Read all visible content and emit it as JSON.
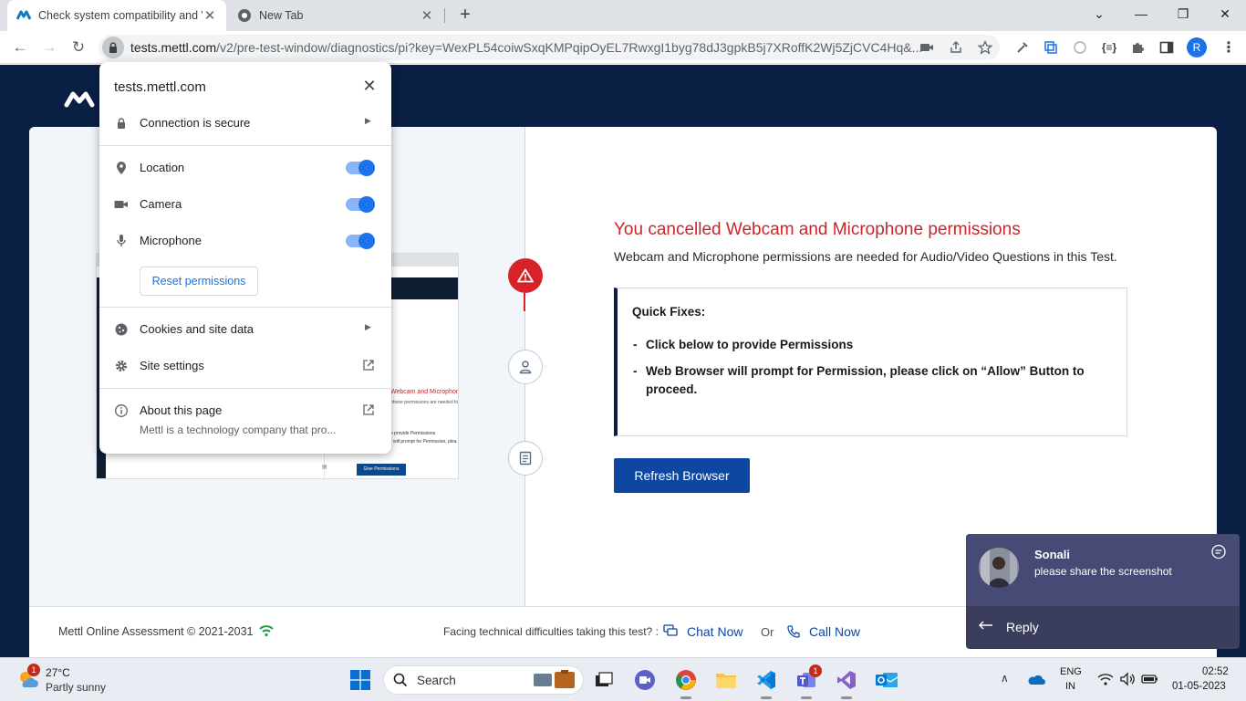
{
  "browser": {
    "tabs": [
      {
        "title": "Check system compatibility and Ve",
        "active": true
      },
      {
        "title": "New Tab",
        "active": false
      }
    ],
    "url_host": "tests.mettl.com",
    "url_path": "/v2/pre-test-window/diagnostics/pi?key=WexPL54coiwSxqKMPqipOyEL7RwxgI1byg78dJ3gpkB5j7XRoffK2Wj5ZjCVC4Hq&...",
    "profile_initial": "R",
    "window_controls": [
      "minimize",
      "restore",
      "close"
    ]
  },
  "site_info_popup": {
    "host": "tests.mettl.com",
    "connection_label": "Connection is secure",
    "permissions": [
      {
        "label": "Location",
        "icon": "location-pin-icon",
        "enabled": true
      },
      {
        "label": "Camera",
        "icon": "camera-icon",
        "enabled": true
      },
      {
        "label": "Microphone",
        "icon": "microphone-icon",
        "enabled": true
      }
    ],
    "reset_label": "Reset permissions",
    "cookies_label": "Cookies and site data",
    "site_settings_label": "Site settings",
    "about_label": "About this page",
    "about_sub": "Mettl is a technology company that pro..."
  },
  "preview_image": {
    "title": "Webcam and Microphor",
    "subtitle": "phone permissions are needed fo",
    "line1": "o provide Permissions",
    "line2": "r will prompt for Permission, plea",
    "button": "Give Permissions"
  },
  "main": {
    "error_title": "You cancelled Webcam and Microphone permissions",
    "error_subtitle": "Webcam and Microphone permissions are needed for Audio/Video Questions in this Test.",
    "fixes_heading": "Quick Fixes:",
    "fixes": [
      "Click below to provide Permissions",
      "Web Browser will prompt for Permission, please click on “Allow” Button to proceed."
    ],
    "dash": "-",
    "refresh_button": "Refresh Browser"
  },
  "footer": {
    "copyright": "Mettl Online Assessment © 2021-2031",
    "help_text": "Facing technical difficulties taking this test? :",
    "chat_label": "Chat Now",
    "or_label": "Or",
    "call_label": "Call Now"
  },
  "toast": {
    "sender": "Sonali",
    "message": "please share the screenshot",
    "reply_label": "Reply"
  },
  "taskbar": {
    "weather_temp": "27°C",
    "weather_desc": "Partly sunny",
    "weather_badge": "1",
    "search_label": "Search",
    "teams_badge": "1",
    "lang_top": "ENG",
    "lang_bottom": "IN",
    "time": "02:52",
    "date": "01-05-2023"
  },
  "colors": {
    "page_navy": "#0a1f44",
    "error_red": "#c8262b",
    "button_blue": "#0d47a1",
    "toggle_blue": "#1a73e8"
  }
}
